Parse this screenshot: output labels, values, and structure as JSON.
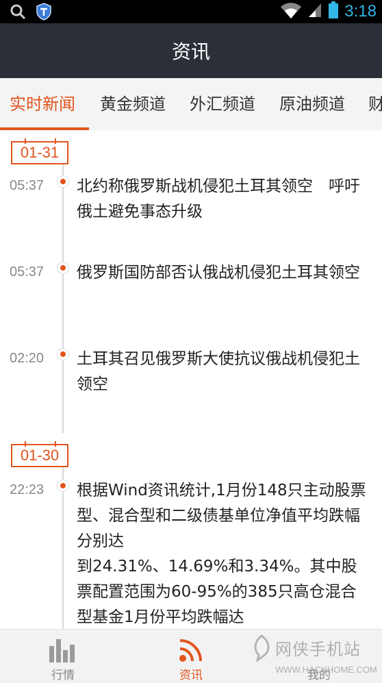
{
  "status_bar": {
    "time": "3:18"
  },
  "header": {
    "title": "资讯"
  },
  "tabs": [
    {
      "label": "实时新闻",
      "active": true
    },
    {
      "label": "黄金频道",
      "active": false
    },
    {
      "label": "外汇频道",
      "active": false
    },
    {
      "label": "原油频道",
      "active": false
    },
    {
      "label": "财",
      "active": false
    }
  ],
  "feed": {
    "groups": [
      {
        "date": "01-31",
        "items": [
          {
            "time": "05:37",
            "text": "北约称俄罗斯战机侵犯土耳其领空　呼吁俄土避免事态升级"
          },
          {
            "time": "05:37",
            "text": "俄罗斯国防部否认俄战机侵犯土耳其领空"
          },
          {
            "time": "02:20",
            "text": "土耳其召见俄罗斯大使抗议俄战机侵犯土领空"
          }
        ]
      },
      {
        "date": "01-30",
        "items": [
          {
            "time": "22:23",
            "text": "根据Wind资讯统计,1月份148只主动股票型、混合型和二级债基单位净值平均跌幅分别达\n到24.31%、14.69%和3.34%。其中股票配置范围为60-95%的385只高仓混合型基金1月份平均跌幅达"
          }
        ]
      }
    ]
  },
  "bottom_nav": [
    {
      "label": "行情",
      "icon": "bar-chart-icon",
      "active": false
    },
    {
      "label": "资讯",
      "icon": "rss-icon",
      "active": true
    },
    {
      "label": "我的",
      "icon": "user-icon",
      "active": false
    }
  ],
  "watermark": {
    "text": "网侠手机站",
    "url": "WWW.HACKHOME.COM"
  },
  "colors": {
    "accent": "#e2541d",
    "header_bg": "#2a2f38",
    "status_icon": "#33b5e5"
  }
}
